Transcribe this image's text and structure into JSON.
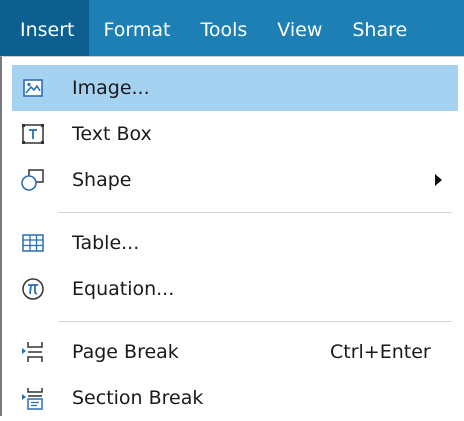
{
  "menubar": {
    "items": [
      {
        "label": "Insert",
        "active": true
      },
      {
        "label": "Format"
      },
      {
        "label": "Tools"
      },
      {
        "label": "View"
      },
      {
        "label": "Share"
      }
    ]
  },
  "menu": {
    "items": [
      {
        "label": "Image...",
        "icon": "image-icon",
        "highlighted": true
      },
      {
        "label": "Text Box",
        "icon": "text-box-icon"
      },
      {
        "label": "Shape",
        "icon": "shape-icon",
        "submenu": true
      },
      {
        "label": "Table...",
        "icon": "table-icon"
      },
      {
        "label": "Equation...",
        "icon": "equation-icon"
      },
      {
        "label": "Page Break",
        "icon": "page-break-icon",
        "shortcut": "Ctrl+Enter"
      },
      {
        "label": "Section Break",
        "icon": "section-break-icon"
      }
    ]
  },
  "colors": {
    "menubar_bg": "#1d7fb4",
    "menubar_active_bg": "#0c5f8e",
    "highlight_bg": "#a6d2f2",
    "icon_accent": "#2b6fb6"
  }
}
